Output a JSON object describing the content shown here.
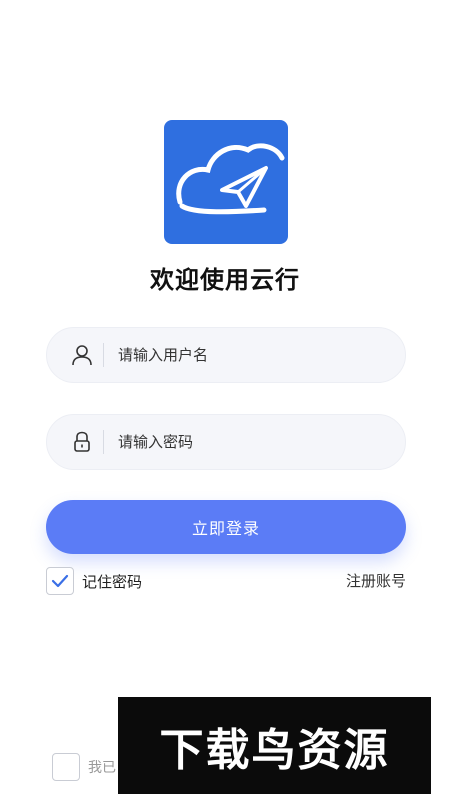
{
  "app": {
    "logo_icon": "cloud-paper-plane-icon",
    "logo_color": "#2f6fe0",
    "welcome_text": "欢迎使用云行"
  },
  "form": {
    "username": {
      "placeholder": "请输入用户名",
      "value": "",
      "icon": "user-icon"
    },
    "password": {
      "placeholder": "请输入密码",
      "value": "",
      "icon": "lock-icon"
    },
    "login_label": "立即登录",
    "login_color": "#5b7cf6",
    "remember_label": "记住密码",
    "remember_checked": true,
    "register_label": "注册账号"
  },
  "agreement": {
    "text_visible": "我已",
    "checked": false
  },
  "watermark": {
    "text": "下载鸟资源"
  }
}
